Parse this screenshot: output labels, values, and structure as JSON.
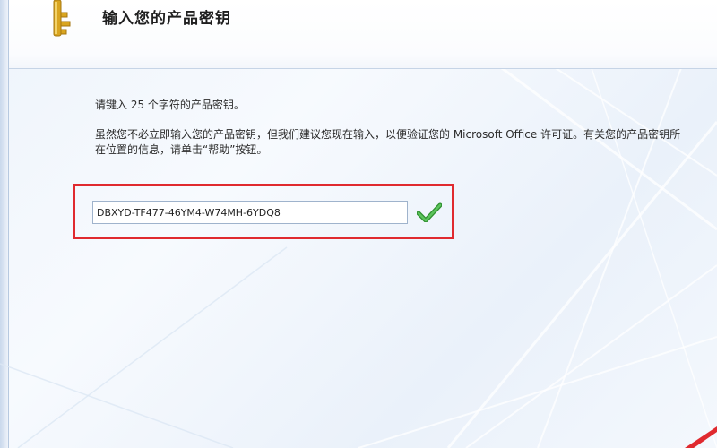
{
  "dialog": {
    "title": "输入您的产品密钥",
    "instruction": "请键入 25 个字符的产品密钥。",
    "info": "虽然您不必立即输入您的产品密钥，但我们建议您现在输入，以便验证您的 Microsoft Office 许可证。有关您的产品密钥所在位置的信息，请单击“帮助”按钮。"
  },
  "product_key": {
    "value": "DBXYD-TF477-46YM4-W74MH-6YDQ8",
    "status": "valid"
  },
  "icons": {
    "header": "key-icon",
    "validation": "checkmark-icon"
  },
  "colors": {
    "highlight": "#e02a2f",
    "checkmark": "#3aa53a",
    "key": "#d9a520"
  }
}
